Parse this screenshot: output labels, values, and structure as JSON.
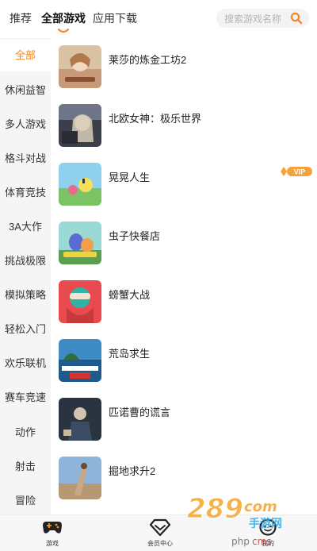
{
  "top_tabs": [
    {
      "label": "推荐"
    },
    {
      "label": "全部游戏"
    },
    {
      "label": "应用下载"
    }
  ],
  "search": {
    "placeholder": "搜索游戏名称",
    "icon": "search-icon"
  },
  "sidebar": {
    "items": [
      {
        "label": "全部"
      },
      {
        "label": "休闲益智"
      },
      {
        "label": "多人游戏"
      },
      {
        "label": "格斗对战"
      },
      {
        "label": "体育竞技"
      },
      {
        "label": "3A大作"
      },
      {
        "label": "挑战极限"
      },
      {
        "label": "模拟策略"
      },
      {
        "label": "轻松入门"
      },
      {
        "label": "欢乐联机"
      },
      {
        "label": "赛车竞速"
      },
      {
        "label": "动作"
      },
      {
        "label": "射击"
      },
      {
        "label": "冒险"
      }
    ]
  },
  "games": [
    {
      "name": "莱莎的炼金工坊2"
    },
    {
      "name": "北欧女神：极乐世界"
    },
    {
      "name": "晃晃人生",
      "badge": "VIP"
    },
    {
      "name": "虫子快餐店"
    },
    {
      "name": "螃蟹大战"
    },
    {
      "name": "荒岛求生"
    },
    {
      "name": "匹诺曹的谎言"
    },
    {
      "name": "掘地求升2"
    }
  ],
  "bottom_nav": [
    {
      "label": "游戏",
      "icon": "gamepad-icon"
    },
    {
      "label": "会员中心",
      "icon": "diamond-icon"
    },
    {
      "label": "我的",
      "icon": "face-icon"
    }
  ],
  "colors": {
    "accent": "#f0882a",
    "sidebar_bg": "#f5f5f5",
    "vip": "#f6a23c"
  }
}
